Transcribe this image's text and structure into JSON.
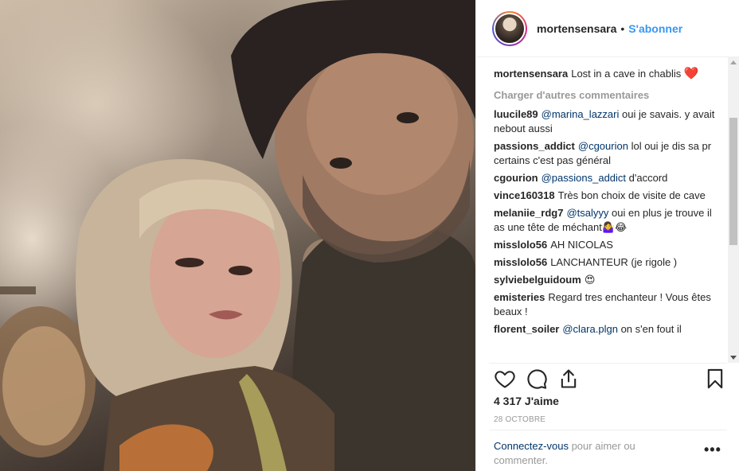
{
  "header": {
    "username": "mortensensara",
    "separator": "•",
    "follow_label": "S'abonner"
  },
  "caption": {
    "username": "mortensensara",
    "text": "Lost in a cave in chablis",
    "emoji": "❤️"
  },
  "load_more_label": "Charger d'autres commentaires",
  "comments": [
    {
      "username": "luucile89",
      "mention": "@marina_lazzari",
      "text": "oui je savais. y avait nebout aussi"
    },
    {
      "username": "passions_addict",
      "mention": "@cgourion",
      "text": "lol oui je dis sa pr certains c'est pas général"
    },
    {
      "username": "cgourion",
      "mention": "@passions_addict",
      "text": "d'accord"
    },
    {
      "username": "vince160318",
      "mention": "",
      "text": "Très bon choix de visite de cave"
    },
    {
      "username": "melaniie_rdg7",
      "mention": "@tsalyyy",
      "text": "oui en plus je trouve il as une tête de méchant🤷‍♀️😂"
    },
    {
      "username": "misslolo56",
      "mention": "",
      "text": "AH NICOLAS"
    },
    {
      "username": "misslolo56",
      "mention": "",
      "text": "LANCHANTEUR (je rigole )"
    },
    {
      "username": "sylviebelguidoum",
      "mention": "",
      "text": "😍"
    },
    {
      "username": "emisteries",
      "mention": "",
      "text": "Regard tres enchanteur ! Vous êtes beaux !"
    },
    {
      "username": "florent_soiler",
      "mention": "@clara.plgn",
      "text": "on s'en fout il"
    }
  ],
  "actions": {
    "like_icon": "heart-icon",
    "comment_icon": "comment-icon",
    "share_icon": "share-icon",
    "save_icon": "bookmark-icon"
  },
  "likes_text": "4 317 J'aime",
  "date_text": "28 OCTOBRE",
  "login": {
    "link_text": "Connectez-vous",
    "rest_text": "pour aimer ou commenter."
  },
  "more_label": "•••",
  "colors": {
    "link_blue": "#3897f0",
    "mention_blue": "#003569",
    "muted": "#999999",
    "text": "#262626"
  }
}
